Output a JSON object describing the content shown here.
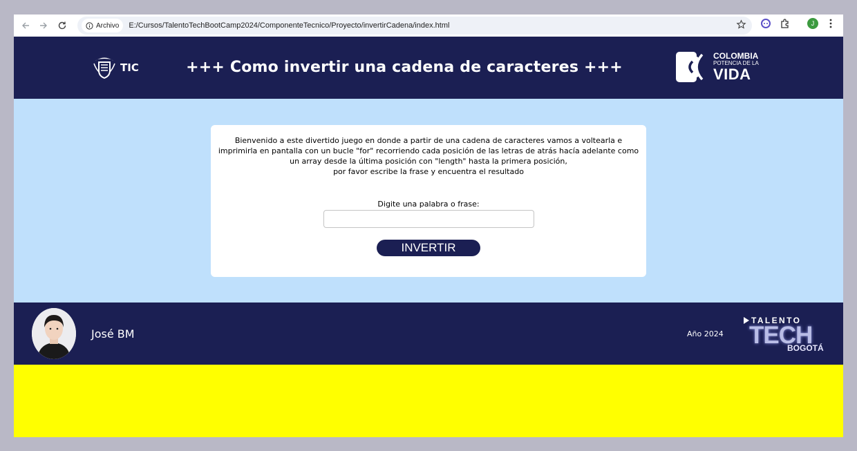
{
  "browser": {
    "site_chip_label": "Archivo",
    "url": "E:/Cursos/TalentoTechBootCamp2024/ComponenteTecnico/Proyecto/invertirCadena/index.html",
    "profile_initial": "J"
  },
  "header": {
    "logo_text": "TIC",
    "title": "+++ Como invertir una cadena de caracteres +++",
    "brand_line1": "COLOMBIA",
    "brand_line2": "POTENCIA DE LA",
    "brand_line3": "VIDA"
  },
  "main": {
    "intro_lines": [
      "Bienvenido a este divertido juego en donde a partir de una cadena de caracteres vamos a voltearla e",
      "imprimirla en pantalla con un bucle \"for\" recorriendo cada posición de las letras de atrás hacía adelante como",
      "un array desde la última posición con \"length\" hasta la primera posición,",
      "por favor escribe la frase y encuentra el resultado"
    ],
    "input_label": "Digite una palabra o frase:",
    "input_value": "",
    "button_label": "INVERTIR"
  },
  "footer": {
    "author": "José BM",
    "year": "Año 2024",
    "logo_top": "TALENTO",
    "logo_main": "TECH",
    "logo_city": "BOGOTÁ"
  },
  "colors": {
    "navy": "#1b1f53",
    "light_blue": "#bfe0fc",
    "yellow": "#ffff00"
  }
}
